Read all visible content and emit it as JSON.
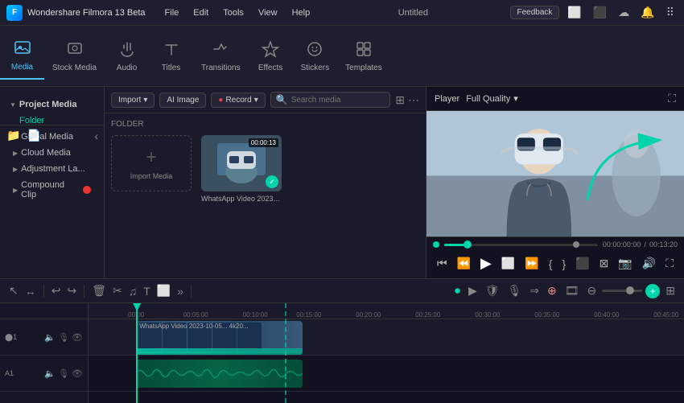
{
  "titlebar": {
    "app_name": "Wondershare Filmora 13 Beta",
    "window_title": "Untitled",
    "feedback_label": "Feedback",
    "menu_items": [
      "File",
      "Edit",
      "Tools",
      "View",
      "Help"
    ]
  },
  "toolbar": {
    "items": [
      {
        "id": "media",
        "label": "Media",
        "icon": "media-icon"
      },
      {
        "id": "stock-media",
        "label": "Stock Media",
        "icon": "stock-icon"
      },
      {
        "id": "audio",
        "label": "Audio",
        "icon": "audio-icon"
      },
      {
        "id": "titles",
        "label": "Titles",
        "icon": "titles-icon"
      },
      {
        "id": "transitions",
        "label": "Transitions",
        "icon": "transitions-icon"
      },
      {
        "id": "effects",
        "label": "Effects",
        "icon": "effects-icon"
      },
      {
        "id": "stickers",
        "label": "Stickers",
        "icon": "stickers-icon"
      },
      {
        "id": "templates",
        "label": "Templates",
        "icon": "templates-icon"
      }
    ]
  },
  "sidebar": {
    "project_media_label": "Project Media",
    "folder_label": "Folder",
    "items": [
      {
        "id": "global-media",
        "label": "Global Media"
      },
      {
        "id": "cloud-media",
        "label": "Cloud Media"
      },
      {
        "id": "adjustment-la",
        "label": "Adjustment La..."
      },
      {
        "id": "compound-clip",
        "label": "Compound Clip"
      }
    ]
  },
  "media_panel": {
    "folder_heading": "FOLDER",
    "import_btn": "Import",
    "ai_image_btn": "AI Image",
    "record_btn": "Record",
    "search_placeholder": "Search media",
    "import_media_label": "Import Media",
    "video_thumb": {
      "time": "00:00:13",
      "label": "WhatsApp Video 2023-10-05..."
    }
  },
  "player": {
    "label": "Player",
    "quality": "Full Quality",
    "current_time": "00:00:00:00",
    "total_time": "00:13:20"
  },
  "timeline": {
    "tracks": [
      {
        "num": "A1"
      }
    ],
    "ruler_marks": [
      "00:00:05:00",
      "00:00:10:00",
      "00:00:15:00",
      "00:00:20:00",
      "00:00:25:00",
      "00:00:30:00",
      "00:00:35:00",
      "00:00:40:00",
      "00:00:45:00"
    ],
    "clip_label": "WhatsApp Video 2023-10-05... 4k20...",
    "zoom_label": "zoom"
  }
}
